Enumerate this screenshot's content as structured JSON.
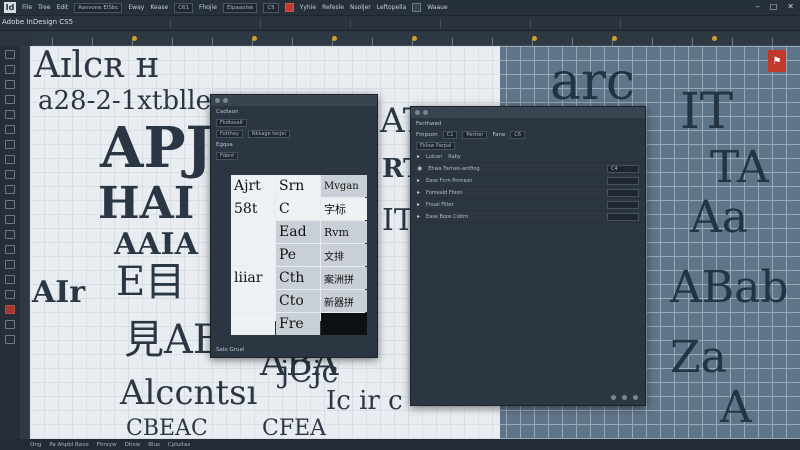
{
  "app": {
    "title": "Adobe InDesign CS5"
  },
  "menubar": {
    "items": [
      "File",
      "Tree",
      "Edit",
      "Eway",
      "Kease",
      "Fhojie",
      "Yyhie",
      "Refesle",
      "Nsoljer",
      "Leftopella",
      "Waaue"
    ],
    "fields": [
      "Rasvone ElSbc",
      "C61",
      "Elpaaolse",
      "C5"
    ]
  },
  "window_controls": [
    "–",
    "□",
    "✕"
  ],
  "canvas": {
    "glyphs_left": [
      "Aɪlcʀ ʜ",
      "a28-2-1xtblleng",
      "APJ",
      "HAI",
      "AAIA",
      "E目",
      "AIr",
      "見ABA",
      "Alccntsı",
      "CBEAC"
    ],
    "glyphs_mid": [
      "AT",
      "RTA",
      "IT",
      "ABA",
      "jCjc",
      "Ic ir c",
      "CFEA"
    ],
    "glyphs_right": [
      "arc",
      "IT",
      "TA",
      "Aa",
      "ABab",
      "Za",
      "A"
    ]
  },
  "glyph_panel": {
    "tab": "Cadlaon",
    "subtab": "Fkdtasalt",
    "font_label": "Fotthey",
    "font_value": "Nkkage tecjel",
    "filter_label": "Egqsa",
    "show_label": "Fdent",
    "cells": [
      "Ajrt",
      "Srn",
      "Mvgan",
      "58t",
      "C",
      "字标",
      "",
      "Ead",
      "Rvm",
      "",
      "Pe",
      "文排",
      "liiar",
      "Cth",
      "案洲拼",
      "",
      "Cto",
      "新器拼",
      "",
      "Fre",
      ""
    ],
    "footer": "Salo Gruel"
  },
  "layers_panel": {
    "tab": "Ferthwed",
    "field1_label": "Fmpson",
    "field1_value": "C1",
    "field2_value": "Pertrer",
    "field3_label": "Fane",
    "field3_value": "C6",
    "section": "Fklow Parpal",
    "header_a": "Lulcan",
    "header_b": "Raby",
    "rows": [
      {
        "label": "Ehwa Farneo-antfing",
        "value": "C4"
      },
      {
        "label": "Ease Fnrn Pnrnazn",
        "value": ""
      },
      {
        "label": "Fomeald Fbion",
        "value": ""
      },
      {
        "label": "Fnuel Filter",
        "value": ""
      },
      {
        "label": "Ease Boos Coltrn",
        "value": ""
      }
    ]
  },
  "statusbar": {
    "items": [
      "Ong",
      "Pa Ahpbl Bavo",
      "Fhrxyw",
      "Dtisie",
      "Blus",
      "Cpluitas"
    ]
  }
}
